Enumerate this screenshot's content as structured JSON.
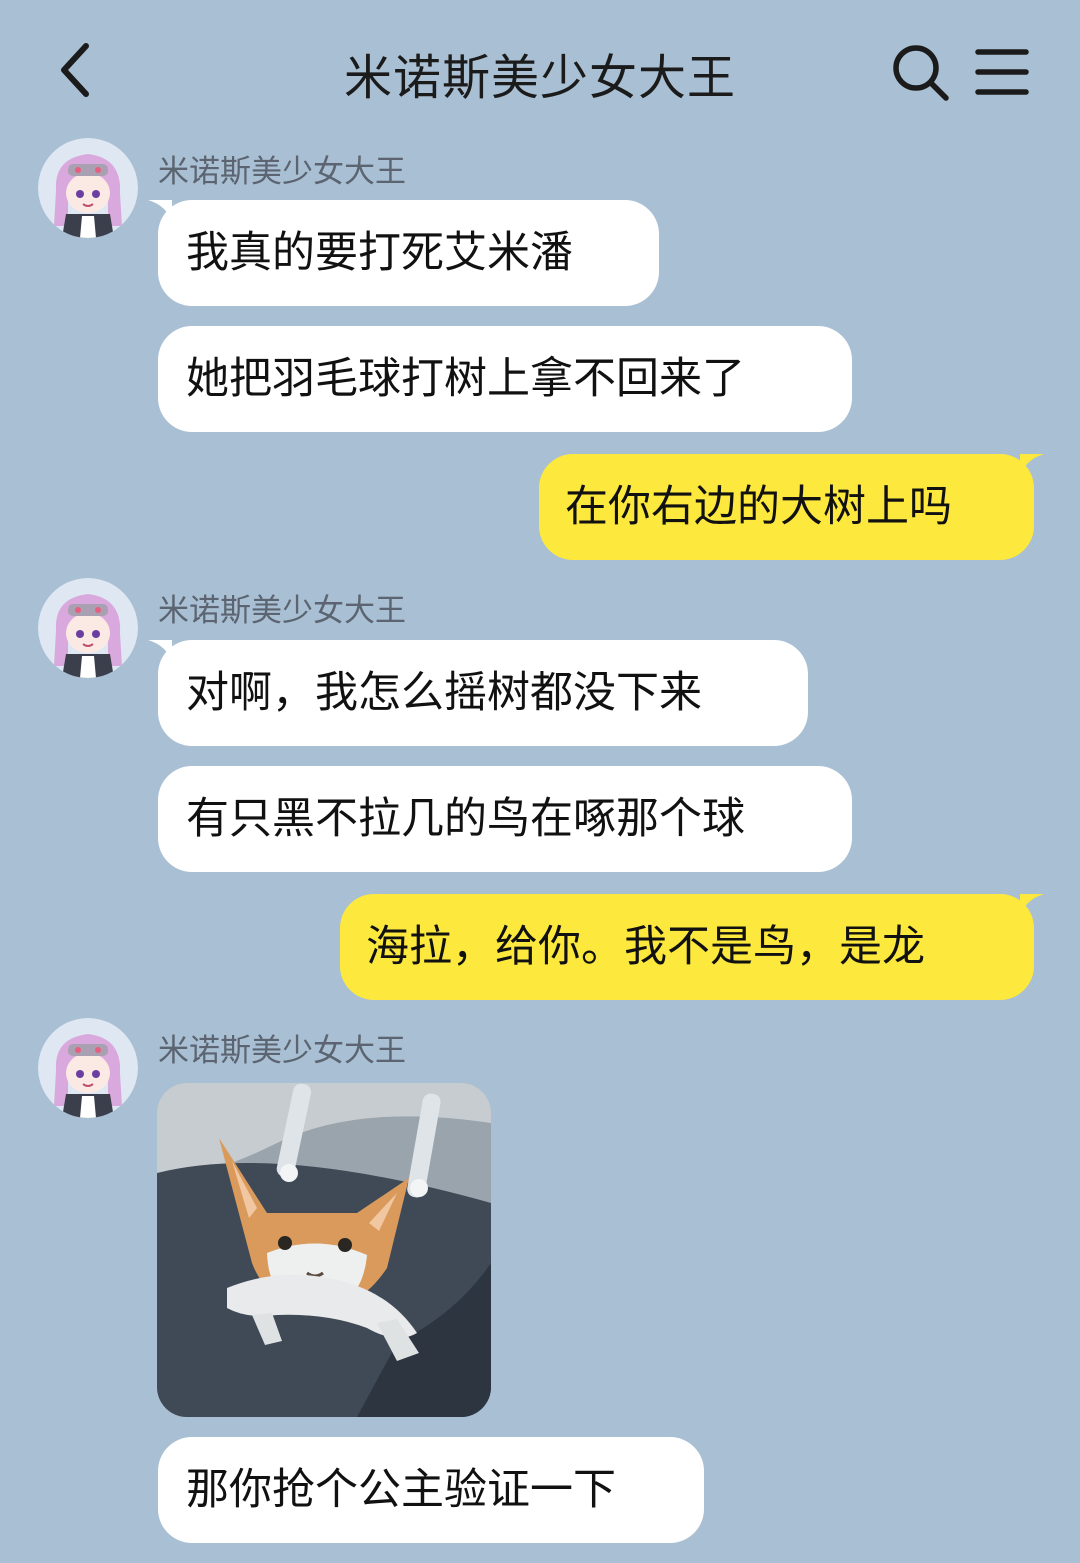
{
  "header": {
    "title": "米诺斯美少女大王",
    "back_icon": "chevron-left-icon",
    "search_icon": "search-icon",
    "menu_icon": "menu-icon"
  },
  "colors": {
    "background": "#a9bfd3",
    "incoming_bubble": "#ffffff",
    "outgoing_bubble": "#fde93d"
  },
  "messages": [
    {
      "sender": "米诺斯美少女大王",
      "text": "我真的要打死艾米潘"
    },
    {
      "text": "她把羽毛球打树上拿不回来了"
    },
    {
      "text": "在你右边的大树上吗"
    },
    {
      "sender": "米诺斯美少女大王",
      "text": "对啊，我怎么摇树都没下来"
    },
    {
      "text": "有只黑不拉几的鸟在啄那个球"
    },
    {
      "text": "海拉，给你。我不是鸟，是龙"
    },
    {
      "sender": "米诺斯美少女大王",
      "image": "cat-sticker-image"
    },
    {
      "text": "那你抢个公主验证一下"
    }
  ]
}
